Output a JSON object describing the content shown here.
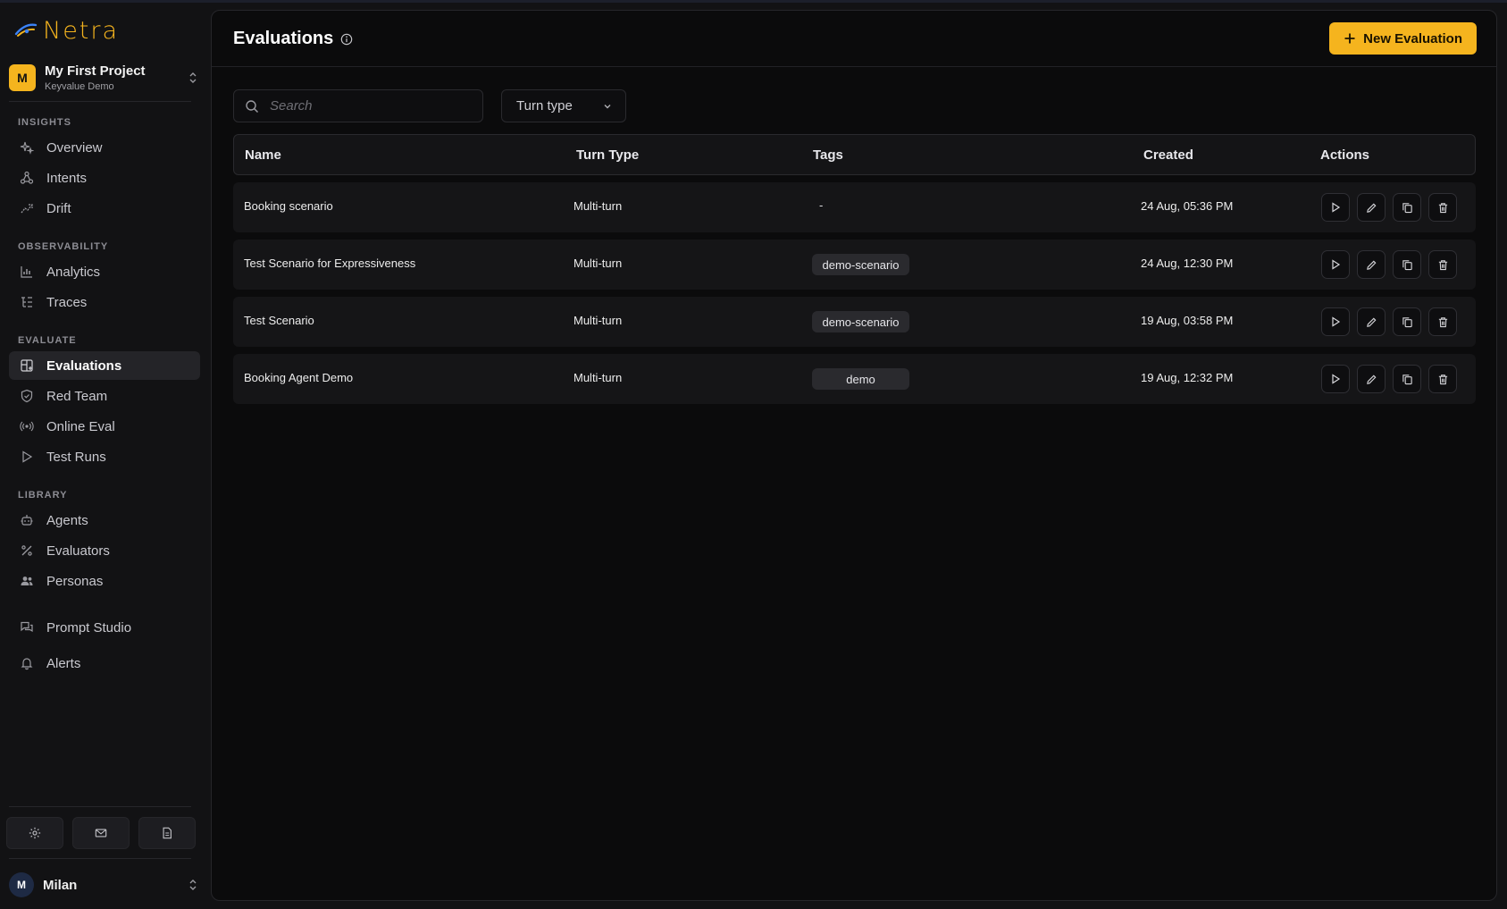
{
  "brand": {
    "name": "Netra",
    "accent": "#f5b41e"
  },
  "project": {
    "initial": "M",
    "name": "My First Project",
    "org": "Keyvalue Demo"
  },
  "sidebar": {
    "sections": [
      {
        "label": "INSIGHTS",
        "items": [
          {
            "label": "Overview",
            "icon": "sparkles-icon"
          },
          {
            "label": "Intents",
            "icon": "network-icon"
          },
          {
            "label": "Drift",
            "icon": "trend-icon"
          }
        ]
      },
      {
        "label": "OBSERVABILITY",
        "items": [
          {
            "label": "Analytics",
            "icon": "chart-icon"
          },
          {
            "label": "Traces",
            "icon": "list-tree-icon"
          }
        ]
      },
      {
        "label": "EVALUATE",
        "items": [
          {
            "label": "Evaluations",
            "icon": "grid-plus-icon",
            "active": true
          },
          {
            "label": "Red Team",
            "icon": "shield-icon"
          },
          {
            "label": "Online Eval",
            "icon": "broadcast-icon"
          },
          {
            "label": "Test Runs",
            "icon": "play-icon"
          }
        ]
      },
      {
        "label": "LIBRARY",
        "items": [
          {
            "label": "Agents",
            "icon": "bot-icon"
          },
          {
            "label": "Evaluators",
            "icon": "percent-icon"
          },
          {
            "label": "Personas",
            "icon": "users-icon"
          }
        ]
      }
    ],
    "extra": [
      {
        "label": "Prompt Studio",
        "icon": "messages-icon"
      },
      {
        "label": "Alerts",
        "icon": "bell-icon"
      }
    ]
  },
  "user": {
    "initial": "M",
    "name": "Milan"
  },
  "page": {
    "title": "Evaluations",
    "new_button": "New Evaluation",
    "search_placeholder": "Search",
    "filter_label": "Turn type"
  },
  "table": {
    "columns": [
      "Name",
      "Turn Type",
      "Tags",
      "Created",
      "Actions"
    ],
    "rows": [
      {
        "name": "Booking scenario",
        "turn_type": "Multi-turn",
        "tag": "-",
        "created": "24 Aug, 05:36 PM"
      },
      {
        "name": "Test Scenario for Expressiveness",
        "turn_type": "Multi-turn",
        "tag": "demo-scenario",
        "created": "24 Aug, 12:30 PM"
      },
      {
        "name": "Test Scenario",
        "turn_type": "Multi-turn",
        "tag": "demo-scenario",
        "created": "19 Aug, 03:58 PM"
      },
      {
        "name": "Booking Agent Demo",
        "turn_type": "Multi-turn",
        "tag": "demo",
        "created": "19 Aug, 12:32 PM"
      }
    ]
  }
}
